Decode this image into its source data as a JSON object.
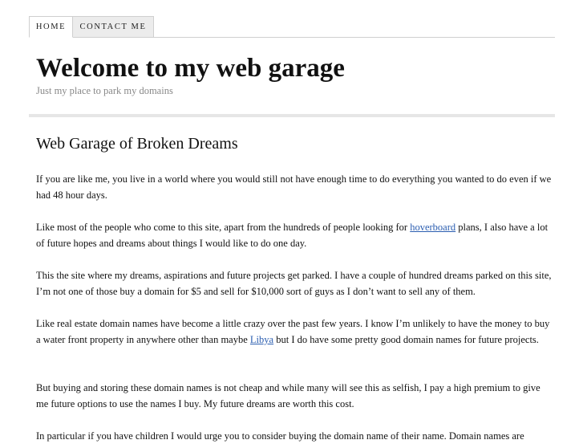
{
  "nav": {
    "tabs": [
      {
        "label": "HOME"
      },
      {
        "label": "CONTACT ME"
      }
    ]
  },
  "header": {
    "title": "Welcome to my web garage",
    "tagline": "Just my place to park my domains"
  },
  "post": {
    "title": "Web Garage of Broken Dreams",
    "p1": "If you are like me, you live in a world where you would still not have enough time to do everything you wanted to do even if we had 48 hour days.",
    "p2_before": "Like most of the people who come to this site, apart from the hundreds of people looking for ",
    "p2_link": "hoverboard",
    "p2_after": " plans, I also have a lot of future hopes and dreams about things I would like to do one day.",
    "p3": "This the site where my dreams, aspirations and future projects get parked. I have a couple of hundred dreams parked on this site, I’m not one of those buy a domain for $5 and sell for $10,000 sort of guys as I don’t want to sell any of them.",
    "p4_before": "Like real estate domain names have become a little crazy over the past few years. I know I’m unlikely to have the money to buy a water front property in anywhere other than maybe ",
    "p4_link": "Libya",
    "p4_after": " but I do have some pretty good domain names for future projects.",
    "p5": "But buying and storing these domain names is not cheap and while many will see this as selfish, I pay a high premium to give me future options to use the names I buy. My future dreams are worth this cost.",
    "p6": "In particular if you have children I would urge you to consider buying the domain name of their name. Domain names are"
  },
  "colors": {
    "link": "#2a5db0",
    "tagline": "#888888",
    "rule": "#e6e6e6",
    "inactive_tab": "#ececec"
  }
}
